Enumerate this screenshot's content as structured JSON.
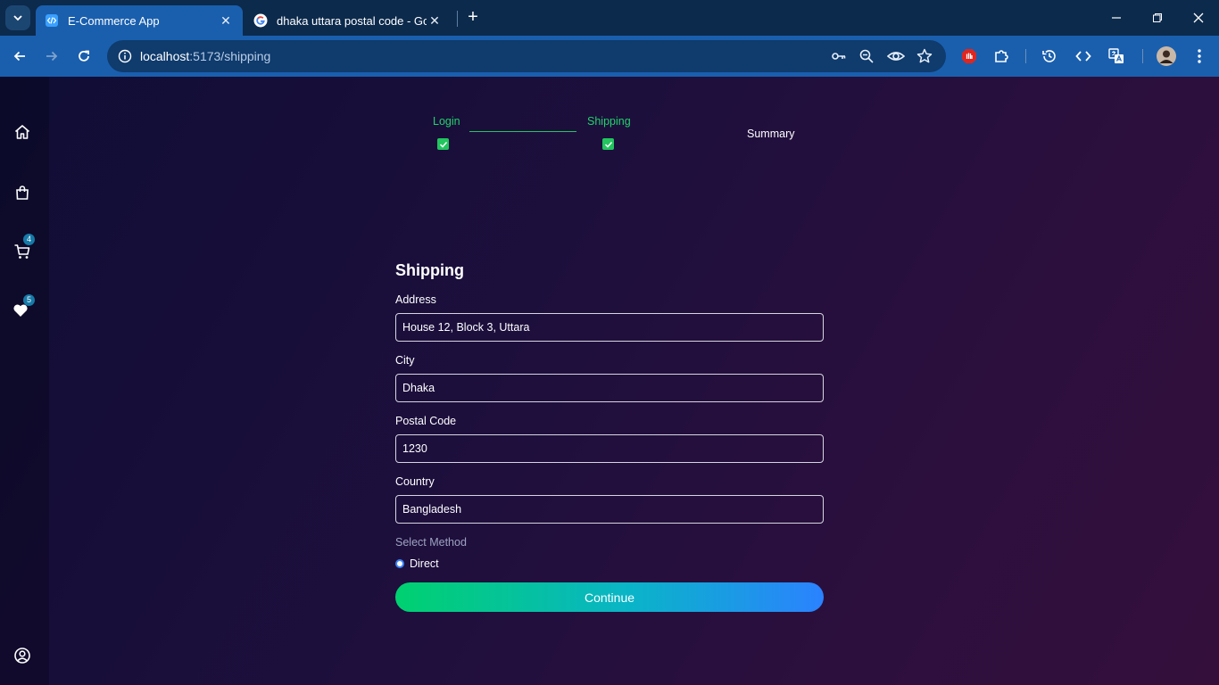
{
  "browser": {
    "tabs": [
      {
        "title": "E-Commerce App",
        "active": true,
        "icon": "code-icon"
      },
      {
        "title": "dhaka uttara postal code - Goo",
        "active": false,
        "icon": "google-icon"
      }
    ],
    "new_tab_label": "+",
    "url_host": "localhost",
    "url_path": ":5173/shipping"
  },
  "sidebar": {
    "items": [
      {
        "name": "home",
        "icon": "home-icon"
      },
      {
        "name": "shop",
        "icon": "shopping-bag-icon"
      },
      {
        "name": "cart",
        "icon": "cart-icon",
        "badge": "4"
      },
      {
        "name": "favorites",
        "icon": "heart-icon",
        "badge": "5"
      },
      {
        "name": "account",
        "icon": "user-circle-icon"
      }
    ]
  },
  "progress": {
    "steps": [
      {
        "label": "Login",
        "done": true
      },
      {
        "label": "Shipping",
        "done": true
      },
      {
        "label": "Summary",
        "done": false
      }
    ]
  },
  "form": {
    "title": "Shipping",
    "fields": [
      {
        "label": "Address",
        "value": "House 12, Block 3, Uttara"
      },
      {
        "label": "City",
        "value": "Dhaka"
      },
      {
        "label": "Postal Code",
        "value": "1230"
      },
      {
        "label": "Country",
        "value": "Bangladesh"
      }
    ],
    "method_label": "Select Method",
    "method_option": "Direct",
    "submit_label": "Continue"
  },
  "colors": {
    "accent_green": "#22c55e",
    "button_gradient_start": "#00d16f",
    "button_gradient_end": "#2b82ff",
    "browser_blue": "#1a5fae"
  }
}
